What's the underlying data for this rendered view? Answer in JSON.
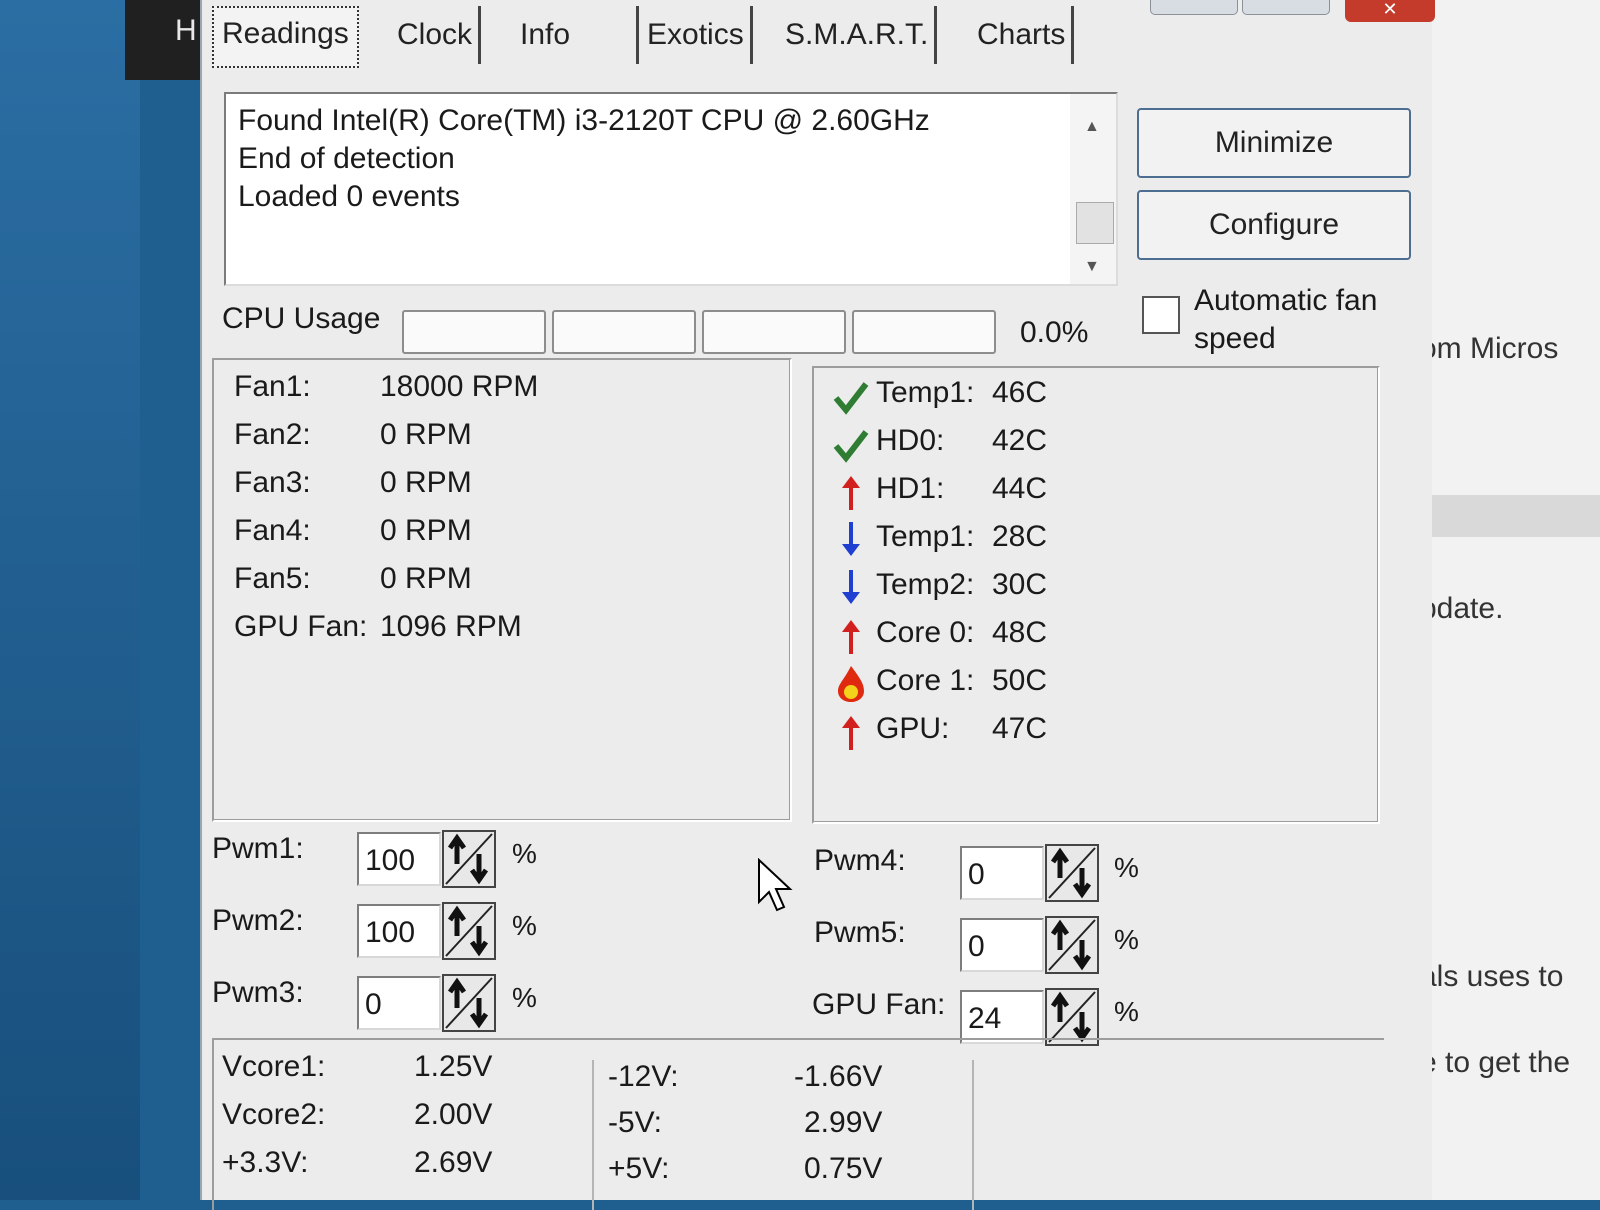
{
  "app": {
    "title_fragment": "H"
  },
  "tabs": [
    {
      "label": "Readings",
      "active": true
    },
    {
      "label": "Clock"
    },
    {
      "label": "Info"
    },
    {
      "label": "Exotics"
    },
    {
      "label": "S.M.A.R.T."
    },
    {
      "label": "Charts"
    }
  ],
  "log": {
    "lines": [
      "Found Intel(R) Core(TM) i3-2120T CPU @ 2.60GHz",
      "End of detection",
      "Loaded 0 events"
    ]
  },
  "buttons": {
    "minimize": "Minimize",
    "configure": "Configure"
  },
  "auto_fan": {
    "label": "Automatic fan speed",
    "checked": false
  },
  "cpu": {
    "label": "CPU Usage",
    "value": "0.0%",
    "segments": [
      0,
      0,
      0,
      0
    ],
    "fill_color": "#3cb44b"
  },
  "fans": [
    {
      "label": "Fan1:",
      "value": "18000 RPM"
    },
    {
      "label": "Fan2:",
      "value": "0 RPM"
    },
    {
      "label": "Fan3:",
      "value": "0 RPM"
    },
    {
      "label": "Fan4:",
      "value": "0 RPM"
    },
    {
      "label": "Fan5:",
      "value": "0 RPM"
    },
    {
      "label": "GPU Fan:",
      "value": "1096 RPM"
    }
  ],
  "temps": [
    {
      "label": "Temp1:",
      "value": "46C",
      "status": "ok",
      "icon": "check-icon"
    },
    {
      "label": "HD0:",
      "value": "42C",
      "status": "ok",
      "icon": "check-icon"
    },
    {
      "label": "HD1:",
      "value": "44C",
      "status": "up",
      "icon": "arrow-up-icon"
    },
    {
      "label": "Temp1:",
      "value": "28C",
      "status": "down",
      "icon": "arrow-down-icon"
    },
    {
      "label": "Temp2:",
      "value": "30C",
      "status": "down",
      "icon": "arrow-down-icon"
    },
    {
      "label": "Core 0:",
      "value": "48C",
      "status": "up",
      "icon": "arrow-up-icon"
    },
    {
      "label": "Core 1:",
      "value": "50C",
      "status": "hot",
      "icon": "flame-icon"
    },
    {
      "label": "GPU:",
      "value": "47C",
      "status": "up",
      "icon": "arrow-up-icon"
    }
  ],
  "status_colors": {
    "ok": "#2f7d32",
    "up": "#d2201f",
    "down": "#1f3fd0",
    "hot_outer": "#e02a10",
    "hot_inner": "#f2d21a"
  },
  "pwm": [
    {
      "label": "Pwm1:",
      "value": "100",
      "unit": "%"
    },
    {
      "label": "Pwm2:",
      "value": "100",
      "unit": "%"
    },
    {
      "label": "Pwm3:",
      "value": "0",
      "unit": "%"
    },
    {
      "label": "Pwm4:",
      "value": "0",
      "unit": "%"
    },
    {
      "label": "Pwm5:",
      "value": "0",
      "unit": "%"
    },
    {
      "label": "GPU Fan:",
      "value": "24",
      "unit": "%"
    }
  ],
  "voltages": [
    {
      "label": "Vcore1:",
      "value": "1.25V"
    },
    {
      "label": "Vcore2:",
      "value": "2.00V"
    },
    {
      "label": "+3.3V:",
      "value": "2.69V"
    },
    {
      "label": "-12V:",
      "value": "-1.66V"
    },
    {
      "label": "-5V:",
      "value": "2.99V"
    },
    {
      "label": "+5V:",
      "value": "0.75V"
    }
  ],
  "background_window": {
    "fragments": [
      "om Micros",
      "pdate.",
      "als uses to",
      "e to get the"
    ]
  }
}
